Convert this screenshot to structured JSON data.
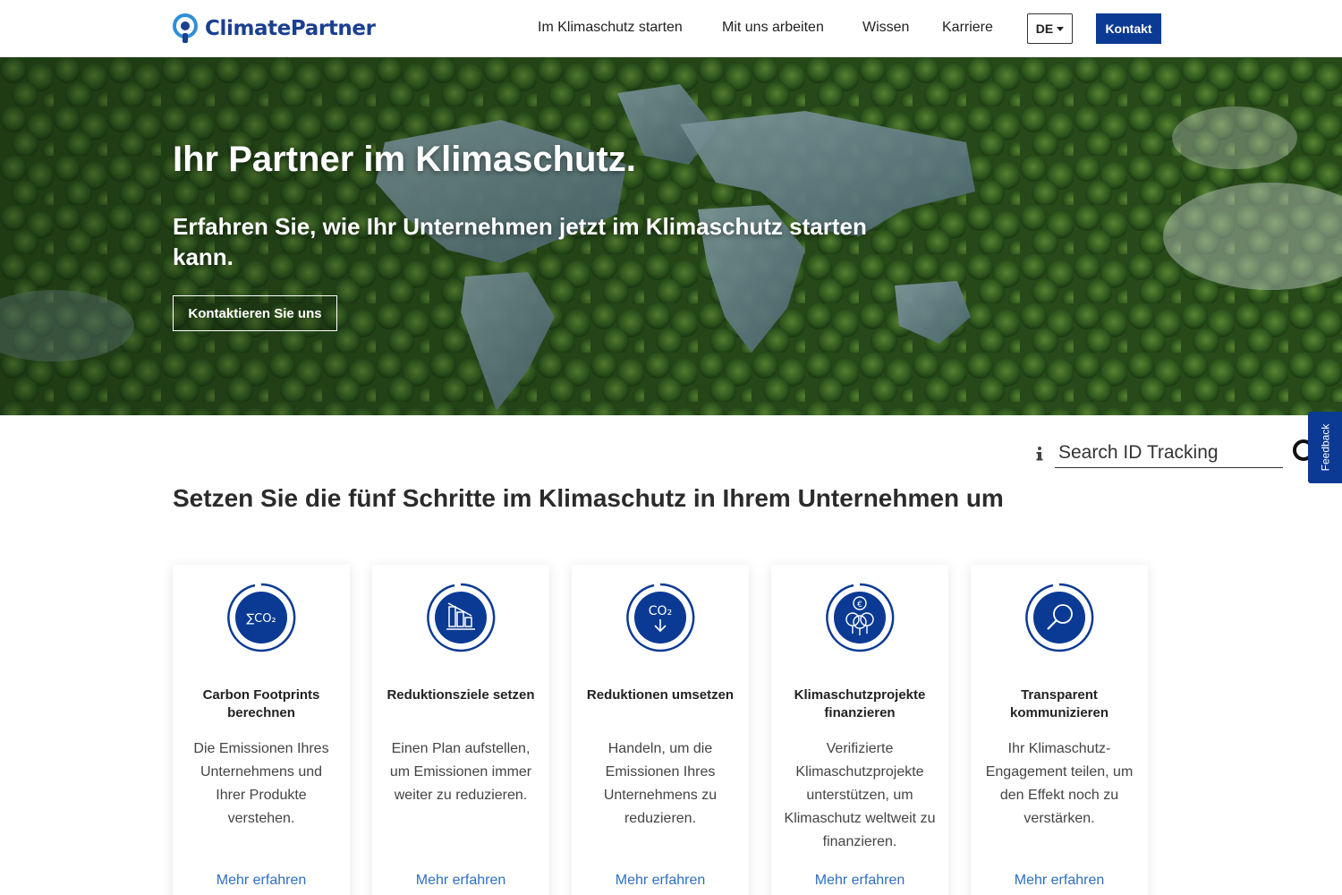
{
  "header": {
    "logo_text": "ClimatePartner",
    "nav": [
      {
        "label": "Im Klimaschutz starten"
      },
      {
        "label": "Mit uns arbeiten"
      },
      {
        "label": "Wissen"
      },
      {
        "label": "Karriere"
      }
    ],
    "language": "DE",
    "contact_label": "Kontakt"
  },
  "hero": {
    "title": "Ihr Partner im Klimaschutz.",
    "subtitle": "Erfahren Sie, wie Ihr Unternehmen jetzt im Klimaschutz starten kann.",
    "cta_label": "Kontaktieren Sie uns"
  },
  "search": {
    "placeholder": "Search ID Tracking"
  },
  "feedback_label": "Feedback",
  "steps": {
    "title": "Setzen Sie die fünf Schritte im Klimaschutz in Ihrem Unternehmen um",
    "cards": [
      {
        "title": "Carbon Footprints berechnen",
        "description": "Die Emissionen Ihres Unternehmens und Ihrer Produkte verstehen.",
        "link": "Mehr erfahren",
        "icon": "sigma-co2-icon"
      },
      {
        "title": "Reduktionsziele setzen",
        "description": "Einen Plan aufstellen, um Emissionen immer weiter zu reduzieren.",
        "link": "Mehr erfahren",
        "icon": "declining-bars-icon"
      },
      {
        "title": "Reduktionen umsetzen",
        "description": "Handeln, um die Emissionen Ihres Unternehmens zu reduzieren.",
        "link": "Mehr erfahren",
        "icon": "co2-down-arrow-icon"
      },
      {
        "title": "Klimaschutzprojekte finanzieren",
        "description": "Verifizierte Klimaschutzprojekte unterstützen, um Klimaschutz weltweit zu finanzieren.",
        "link": "Mehr erfahren",
        "icon": "euro-trees-icon"
      },
      {
        "title": "Transparent kommunizieren",
        "description": "Ihr Klimaschutz-Engagement teilen, um den Effekt noch zu verstärken.",
        "link": "Mehr erfahren",
        "icon": "magnifier-icon"
      }
    ]
  },
  "colors": {
    "brand_blue": "#0b3a94",
    "link_blue": "#2f6fc2"
  }
}
